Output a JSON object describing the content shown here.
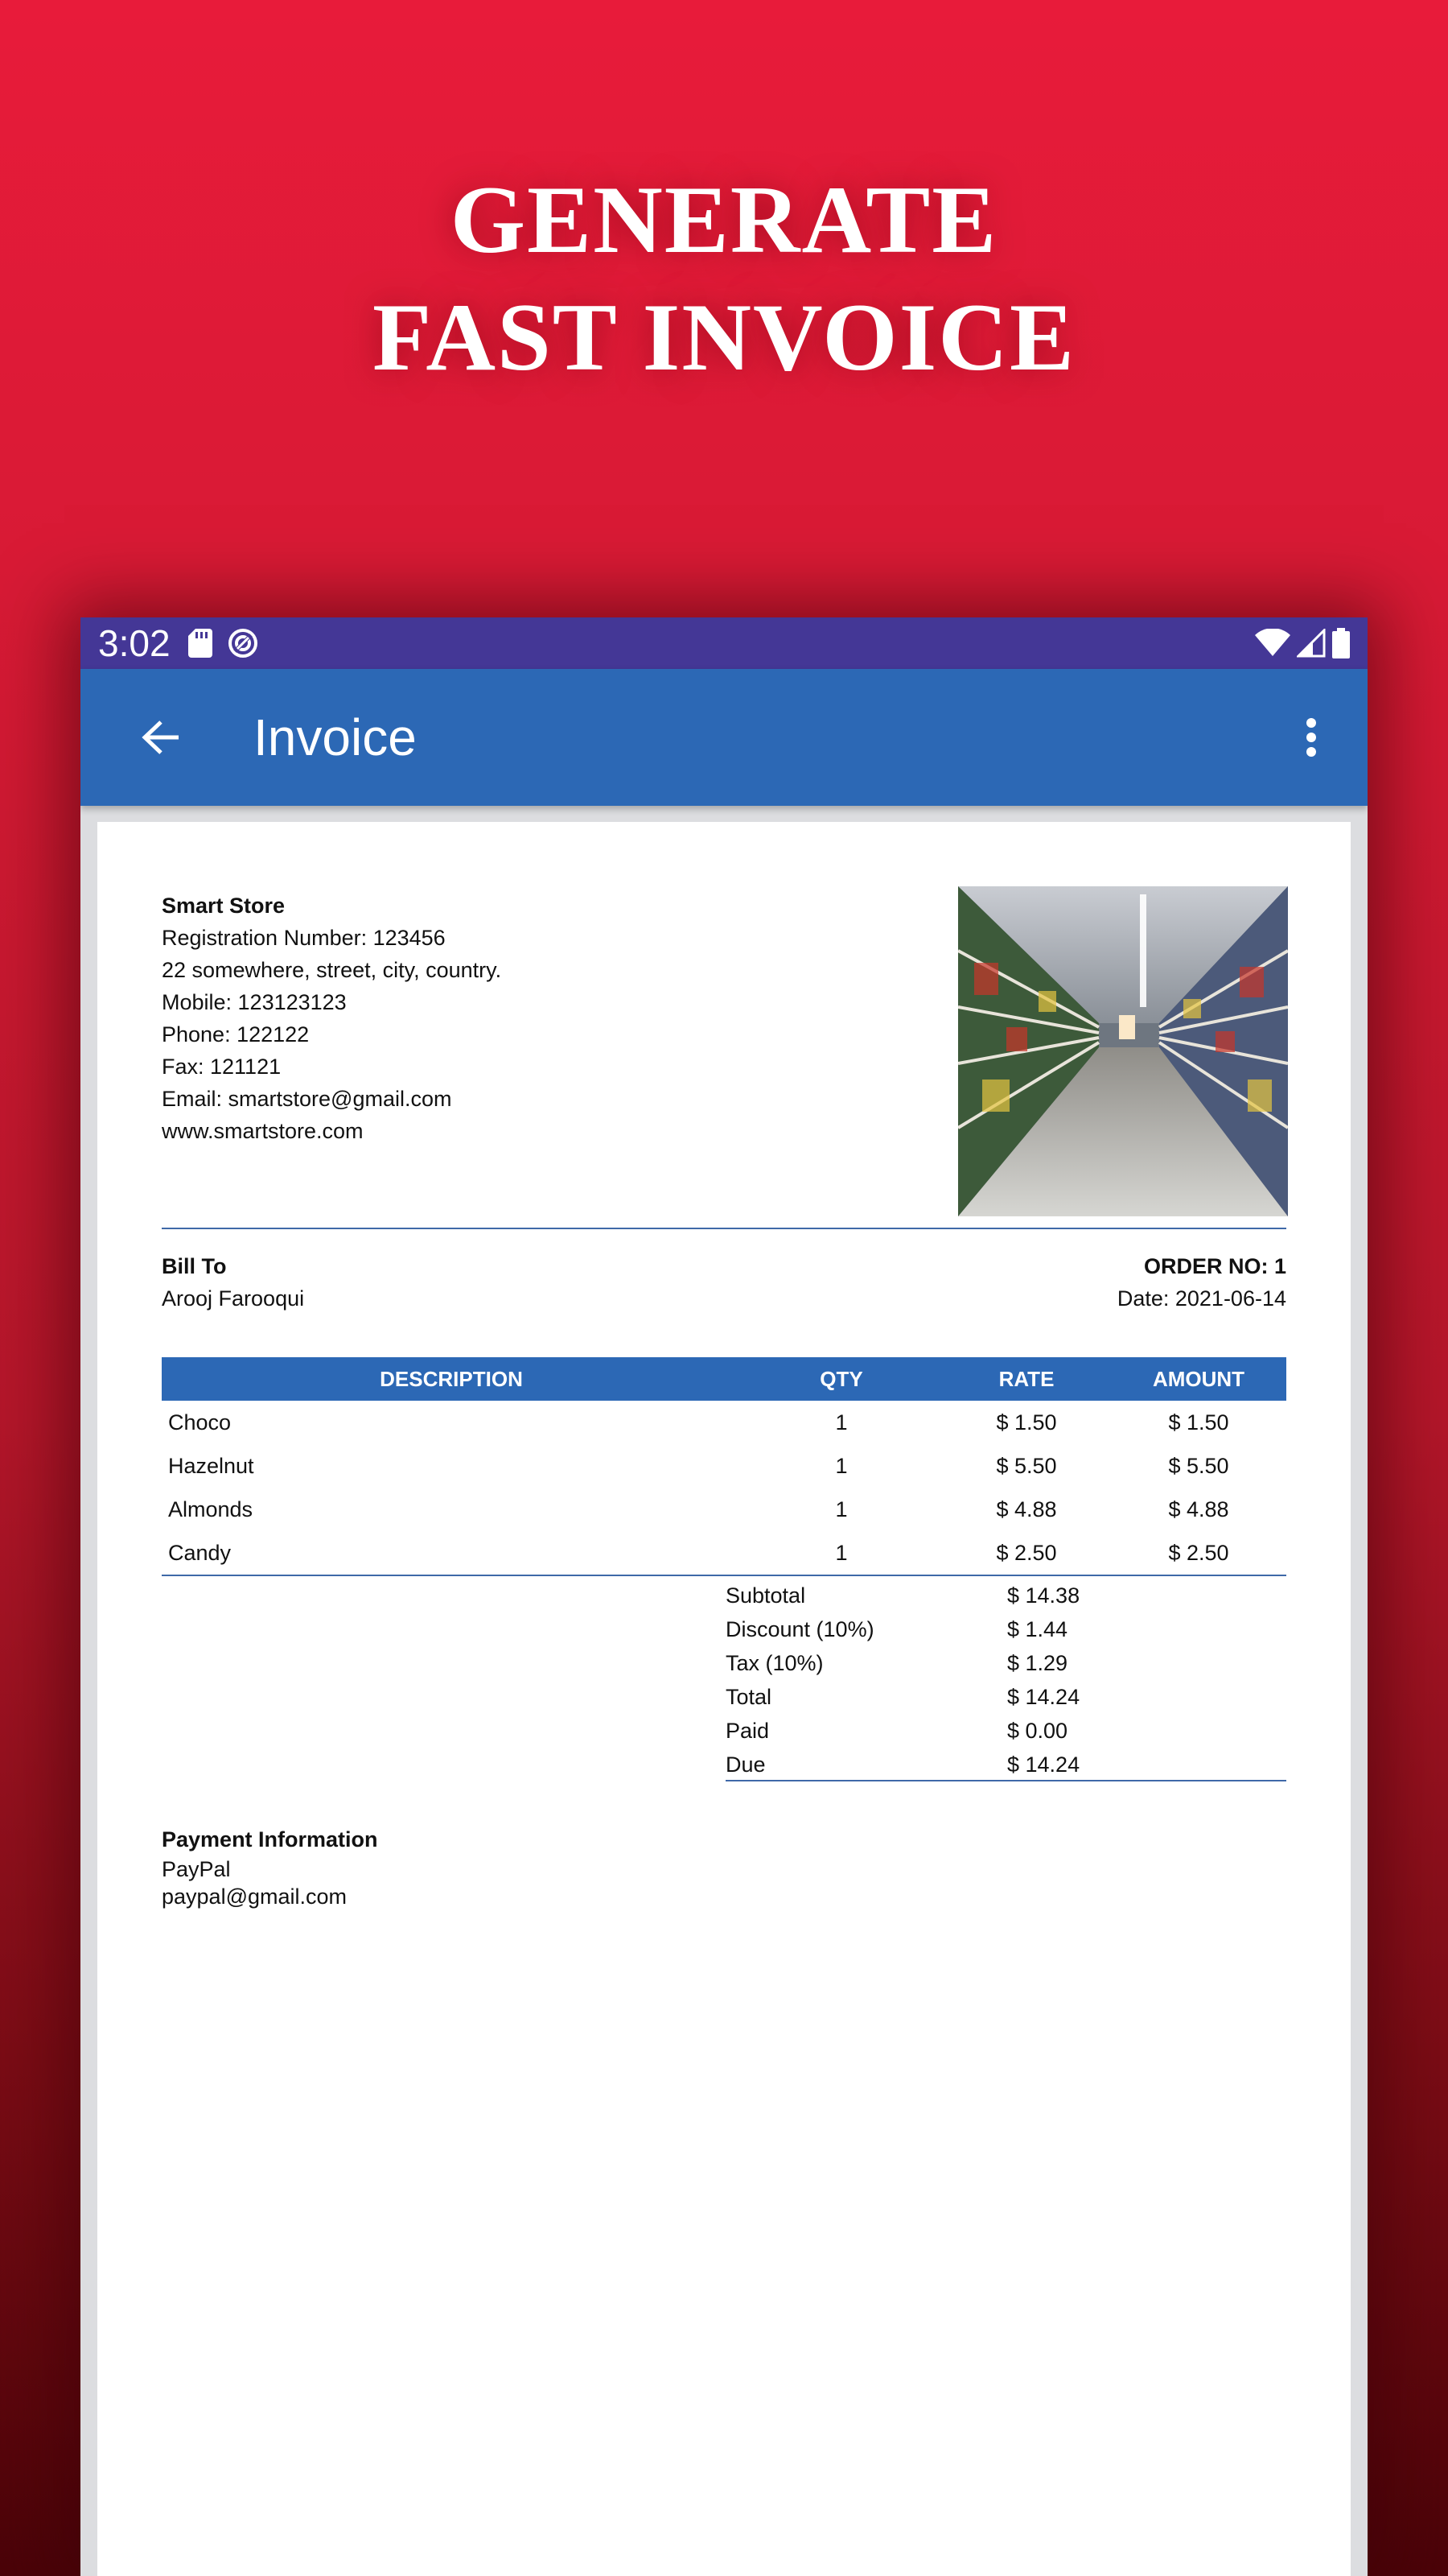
{
  "promo": {
    "line1": "GENERATE",
    "line2": "FAST INVOICE"
  },
  "status_bar": {
    "time": "3:02",
    "left_icons": [
      "sd-card-icon",
      "sync-icon"
    ],
    "right_icons": [
      "wifi-icon",
      "signal-icon",
      "battery-icon"
    ]
  },
  "app_bar": {
    "title": "Invoice"
  },
  "company": {
    "name": "Smart Store",
    "registration": "Registration Number: 123456",
    "address": "22 somewhere, street, city, country.",
    "mobile": "Mobile: 123123123",
    "phone": "Phone: 122122",
    "fax": "Fax: 121121",
    "email": "Email: smartstore@gmail.com",
    "website": "www.smartstore.com"
  },
  "bill_to": {
    "label": "Bill To",
    "name": "Arooj Farooqui"
  },
  "order": {
    "number": "ORDER NO: 1",
    "date": "Date: 2021-06-14"
  },
  "table": {
    "headers": {
      "description": "DESCRIPTION",
      "qty": "QTY",
      "rate": "RATE",
      "amount": "AMOUNT"
    },
    "rows": [
      {
        "description": "Choco",
        "qty": "1",
        "rate": "$ 1.50",
        "amount": "$ 1.50"
      },
      {
        "description": "Hazelnut",
        "qty": "1",
        "rate": "$ 5.50",
        "amount": "$ 5.50"
      },
      {
        "description": "Almonds",
        "qty": "1",
        "rate": "$ 4.88",
        "amount": "$ 4.88"
      },
      {
        "description": "Candy",
        "qty": "1",
        "rate": "$ 2.50",
        "amount": "$ 2.50"
      }
    ]
  },
  "totals": [
    {
      "label": "Subtotal",
      "value": "$ 14.38"
    },
    {
      "label": "Discount (10%)",
      "value": "$ 1.44"
    },
    {
      "label": "Tax (10%)",
      "value": "$ 1.29"
    },
    {
      "label": "Total",
      "value": "$ 14.24"
    },
    {
      "label": "Paid",
      "value": "$ 0.00"
    },
    {
      "label": "Due",
      "value": "$ 14.24"
    }
  ],
  "payment": {
    "label": "Payment Information",
    "method": "PayPal",
    "email": "paypal@gmail.com"
  },
  "colors": {
    "status_bar": "#443796",
    "app_bar": "#2c68b5",
    "table_header": "#2c68b5",
    "rule": "#3f69a8",
    "promo_bg": "#e81b3a"
  }
}
